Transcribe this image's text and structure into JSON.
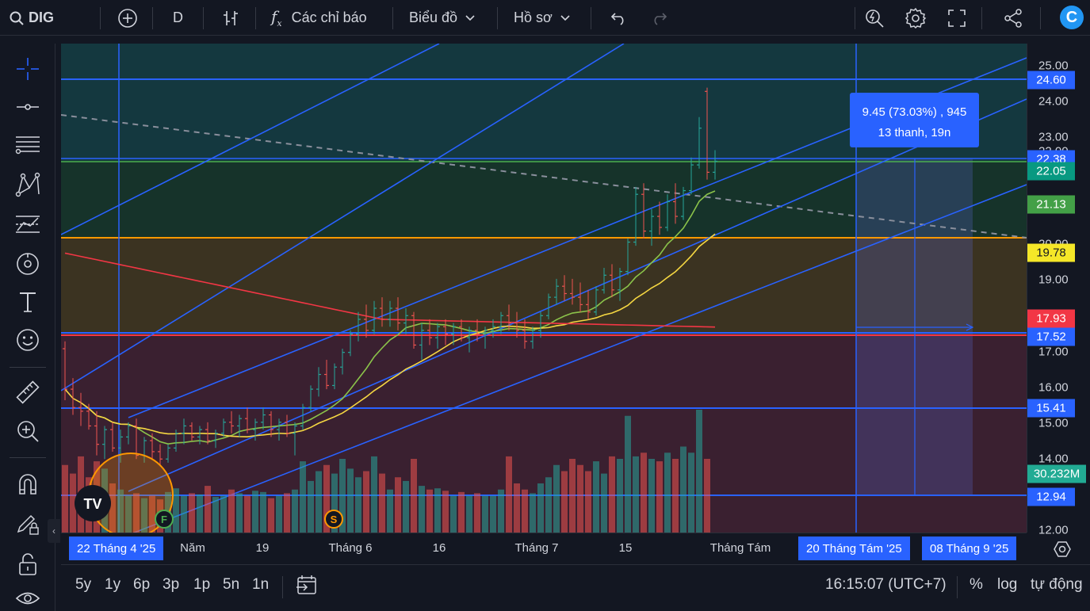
{
  "toolbar": {
    "symbol": "DIG",
    "interval": "D",
    "indicators_label": "Các chỉ báo",
    "chart_type_label": "Biểu đồ",
    "profile_label": "Hồ sơ",
    "logo_letter": "C"
  },
  "price_axis": {
    "ticks": [
      "25.00",
      "24.00",
      "23.00",
      "22.00",
      "20.00",
      "19.00",
      "17.00",
      "16.00",
      "15.00",
      "14.00",
      "12.00"
    ],
    "tags": [
      {
        "label": "24.60",
        "color": "#2962ff"
      },
      {
        "label": "22.38",
        "color": "#2962ff"
      },
      {
        "label": "22.05",
        "color": "#089981"
      },
      {
        "label": "21.13",
        "color": "#43a047"
      },
      {
        "label": "19.78",
        "color": "#f5e728"
      },
      {
        "label": "17.93",
        "color": "#f23645"
      },
      {
        "label": "17.52",
        "color": "#2962ff"
      },
      {
        "label": "15.41",
        "color": "#2962ff"
      },
      {
        "label": "30.232M",
        "color": "#22ab94"
      },
      {
        "label": "12.94",
        "color": "#2962ff"
      }
    ]
  },
  "time_axis": {
    "labels": [
      "Năm",
      "19",
      "Tháng 6",
      "16",
      "Tháng 7",
      "15",
      "Tháng Tám"
    ],
    "tags": [
      "22 Tháng 4 '25",
      "20 Tháng Tám '25",
      "08 Tháng 9 '25"
    ]
  },
  "measure": {
    "line1": "9.45 (73.03%) , 945",
    "line2": "13 thanh, 19n"
  },
  "markers": {
    "f": "F",
    "s": "S"
  },
  "bottom": {
    "ranges": [
      "5y",
      "1y",
      "6p",
      "3p",
      "1p",
      "5n",
      "1n"
    ],
    "time": "16:15:07 (UTC+7)",
    "percent": "%",
    "log": "log",
    "auto": "tự động"
  },
  "colors": {
    "background": "#131722",
    "accent": "#2962ff",
    "up": "#26a69a",
    "down": "#ef5350",
    "ma_yellow": "#f5d742",
    "ma_green": "#8bc34a",
    "ma_red": "#f23645",
    "level_orange": "#ff9800"
  },
  "chart_data": {
    "type": "candlestick",
    "symbol": "DIG",
    "interval": "D",
    "ylim": [
      12.0,
      25.3
    ],
    "candles": [
      [
        17.0,
        17.2,
        15.6,
        15.9
      ],
      [
        15.9,
        16.2,
        15.2,
        15.4
      ],
      [
        15.4,
        15.8,
        14.9,
        15.3
      ],
      [
        15.3,
        15.5,
        14.8,
        14.9
      ],
      [
        14.9,
        15.3,
        14.1,
        14.4
      ],
      [
        14.4,
        14.9,
        14.0,
        14.8
      ],
      [
        14.8,
        15.0,
        14.2,
        14.3
      ],
      [
        14.3,
        14.8,
        13.9,
        14.6
      ],
      [
        14.6,
        15.0,
        14.4,
        14.9
      ],
      [
        14.9,
        15.1,
        14.0,
        14.1
      ],
      [
        14.1,
        14.6,
        13.9,
        14.5
      ],
      [
        14.5,
        14.7,
        14.0,
        14.2
      ],
      [
        14.2,
        14.4,
        13.8,
        14.0
      ],
      [
        14.0,
        14.4,
        13.9,
        14.3
      ],
      [
        14.3,
        14.8,
        14.2,
        14.7
      ],
      [
        14.7,
        15.1,
        14.4,
        14.9
      ],
      [
        14.9,
        15.0,
        14.5,
        14.6
      ],
      [
        14.6,
        14.9,
        14.4,
        14.8
      ],
      [
        14.8,
        15.0,
        14.4,
        14.5
      ],
      [
        14.5,
        14.8,
        14.3,
        14.7
      ],
      [
        14.7,
        15.1,
        14.6,
        15.0
      ],
      [
        15.0,
        15.3,
        14.7,
        14.9
      ],
      [
        14.9,
        15.2,
        14.6,
        15.1
      ],
      [
        15.1,
        15.4,
        14.7,
        14.8
      ],
      [
        14.8,
        15.1,
        14.5,
        15.0
      ],
      [
        15.0,
        15.4,
        14.8,
        15.2
      ],
      [
        15.2,
        15.3,
        14.6,
        14.8
      ],
      [
        14.8,
        15.1,
        14.5,
        15.0
      ],
      [
        15.0,
        15.2,
        14.6,
        14.7
      ],
      [
        14.7,
        15.0,
        14.1,
        14.9
      ],
      [
        14.9,
        15.5,
        14.8,
        15.4
      ],
      [
        15.4,
        16.0,
        15.3,
        15.9
      ],
      [
        15.9,
        16.5,
        15.7,
        16.3
      ],
      [
        16.3,
        16.7,
        15.9,
        16.0
      ],
      [
        16.0,
        16.6,
        15.9,
        16.5
      ],
      [
        16.5,
        17.0,
        16.3,
        16.9
      ],
      [
        16.9,
        17.5,
        16.8,
        17.4
      ],
      [
        17.4,
        18.0,
        17.2,
        17.8
      ],
      [
        17.8,
        18.2,
        17.3,
        17.5
      ],
      [
        17.5,
        18.3,
        17.4,
        18.1
      ],
      [
        18.1,
        18.4,
        17.6,
        17.8
      ],
      [
        17.8,
        18.3,
        17.6,
        18.1
      ],
      [
        18.1,
        18.4,
        17.5,
        17.7
      ],
      [
        17.7,
        18.1,
        17.4,
        17.9
      ],
      [
        17.9,
        18.0,
        17.0,
        17.1
      ],
      [
        17.1,
        17.7,
        16.7,
        17.5
      ],
      [
        17.5,
        17.8,
        17.1,
        17.3
      ],
      [
        17.3,
        17.7,
        17.0,
        17.6
      ],
      [
        17.6,
        17.8,
        17.1,
        17.4
      ],
      [
        17.4,
        17.7,
        17.1,
        17.6
      ],
      [
        17.6,
        17.8,
        17.2,
        17.3
      ],
      [
        17.3,
        17.6,
        16.9,
        17.5
      ],
      [
        17.5,
        17.8,
        17.2,
        17.4
      ],
      [
        17.4,
        17.6,
        17.0,
        17.5
      ],
      [
        17.5,
        17.8,
        17.3,
        17.6
      ],
      [
        17.6,
        18.0,
        17.4,
        17.9
      ],
      [
        17.9,
        18.2,
        17.5,
        17.7
      ],
      [
        17.7,
        18.0,
        17.3,
        17.5
      ],
      [
        17.5,
        17.8,
        17.0,
        17.2
      ],
      [
        17.2,
        17.6,
        17.0,
        17.5
      ],
      [
        17.5,
        18.0,
        17.3,
        17.9
      ],
      [
        17.9,
        18.5,
        17.8,
        18.4
      ],
      [
        18.4,
        18.9,
        18.2,
        18.7
      ],
      [
        18.7,
        19.0,
        18.3,
        18.5
      ],
      [
        18.5,
        18.9,
        18.2,
        18.4
      ],
      [
        18.4,
        18.8,
        18.0,
        18.2
      ],
      [
        18.2,
        18.6,
        17.8,
        18.0
      ],
      [
        18.0,
        18.7,
        17.9,
        18.6
      ],
      [
        18.6,
        19.2,
        18.5,
        19.0
      ],
      [
        19.0,
        19.3,
        18.4,
        18.6
      ],
      [
        18.6,
        19.2,
        18.3,
        19.1
      ],
      [
        19.1,
        20.0,
        19.0,
        19.9
      ],
      [
        19.9,
        21.4,
        19.8,
        21.2
      ],
      [
        21.2,
        21.5,
        20.0,
        20.2
      ],
      [
        20.2,
        20.8,
        19.8,
        20.6
      ],
      [
        20.6,
        21.0,
        20.1,
        20.3
      ],
      [
        20.3,
        21.2,
        20.2,
        21.0
      ],
      [
        21.0,
        21.5,
        20.4,
        20.6
      ],
      [
        20.6,
        21.4,
        20.5,
        21.3
      ],
      [
        21.3,
        22.2,
        21.2,
        22.0
      ],
      [
        22.0,
        23.3,
        21.9,
        23.0
      ],
      [
        24.0,
        24.1,
        21.6,
        21.8
      ],
      [
        21.8,
        22.4,
        21.6,
        22.1
      ]
    ],
    "volume_relative": [
      0.55,
      0.48,
      0.62,
      0.45,
      0.58,
      0.52,
      0.4,
      0.35,
      0.3,
      0.32,
      0.28,
      0.3,
      0.27,
      0.33,
      0.36,
      0.3,
      0.32,
      0.31,
      0.38,
      0.29,
      0.3,
      0.35,
      0.32,
      0.3,
      0.34,
      0.33,
      0.28,
      0.3,
      0.32,
      0.35,
      0.58,
      0.42,
      0.5,
      0.55,
      0.48,
      0.6,
      0.52,
      0.45,
      0.5,
      0.62,
      0.48,
      0.35,
      0.45,
      0.42,
      0.6,
      0.38,
      0.35,
      0.36,
      0.34,
      0.3,
      0.33,
      0.3,
      0.32,
      0.3,
      0.3,
      0.35,
      0.62,
      0.4,
      0.35,
      0.32,
      0.4,
      0.45,
      0.55,
      0.5,
      0.6,
      0.55,
      0.5,
      0.58,
      0.48,
      0.62,
      0.6,
      0.95,
      0.62,
      0.65,
      0.6,
      0.58,
      0.65,
      0.6,
      0.7,
      0.65,
      1.0,
      0.6
    ]
  }
}
